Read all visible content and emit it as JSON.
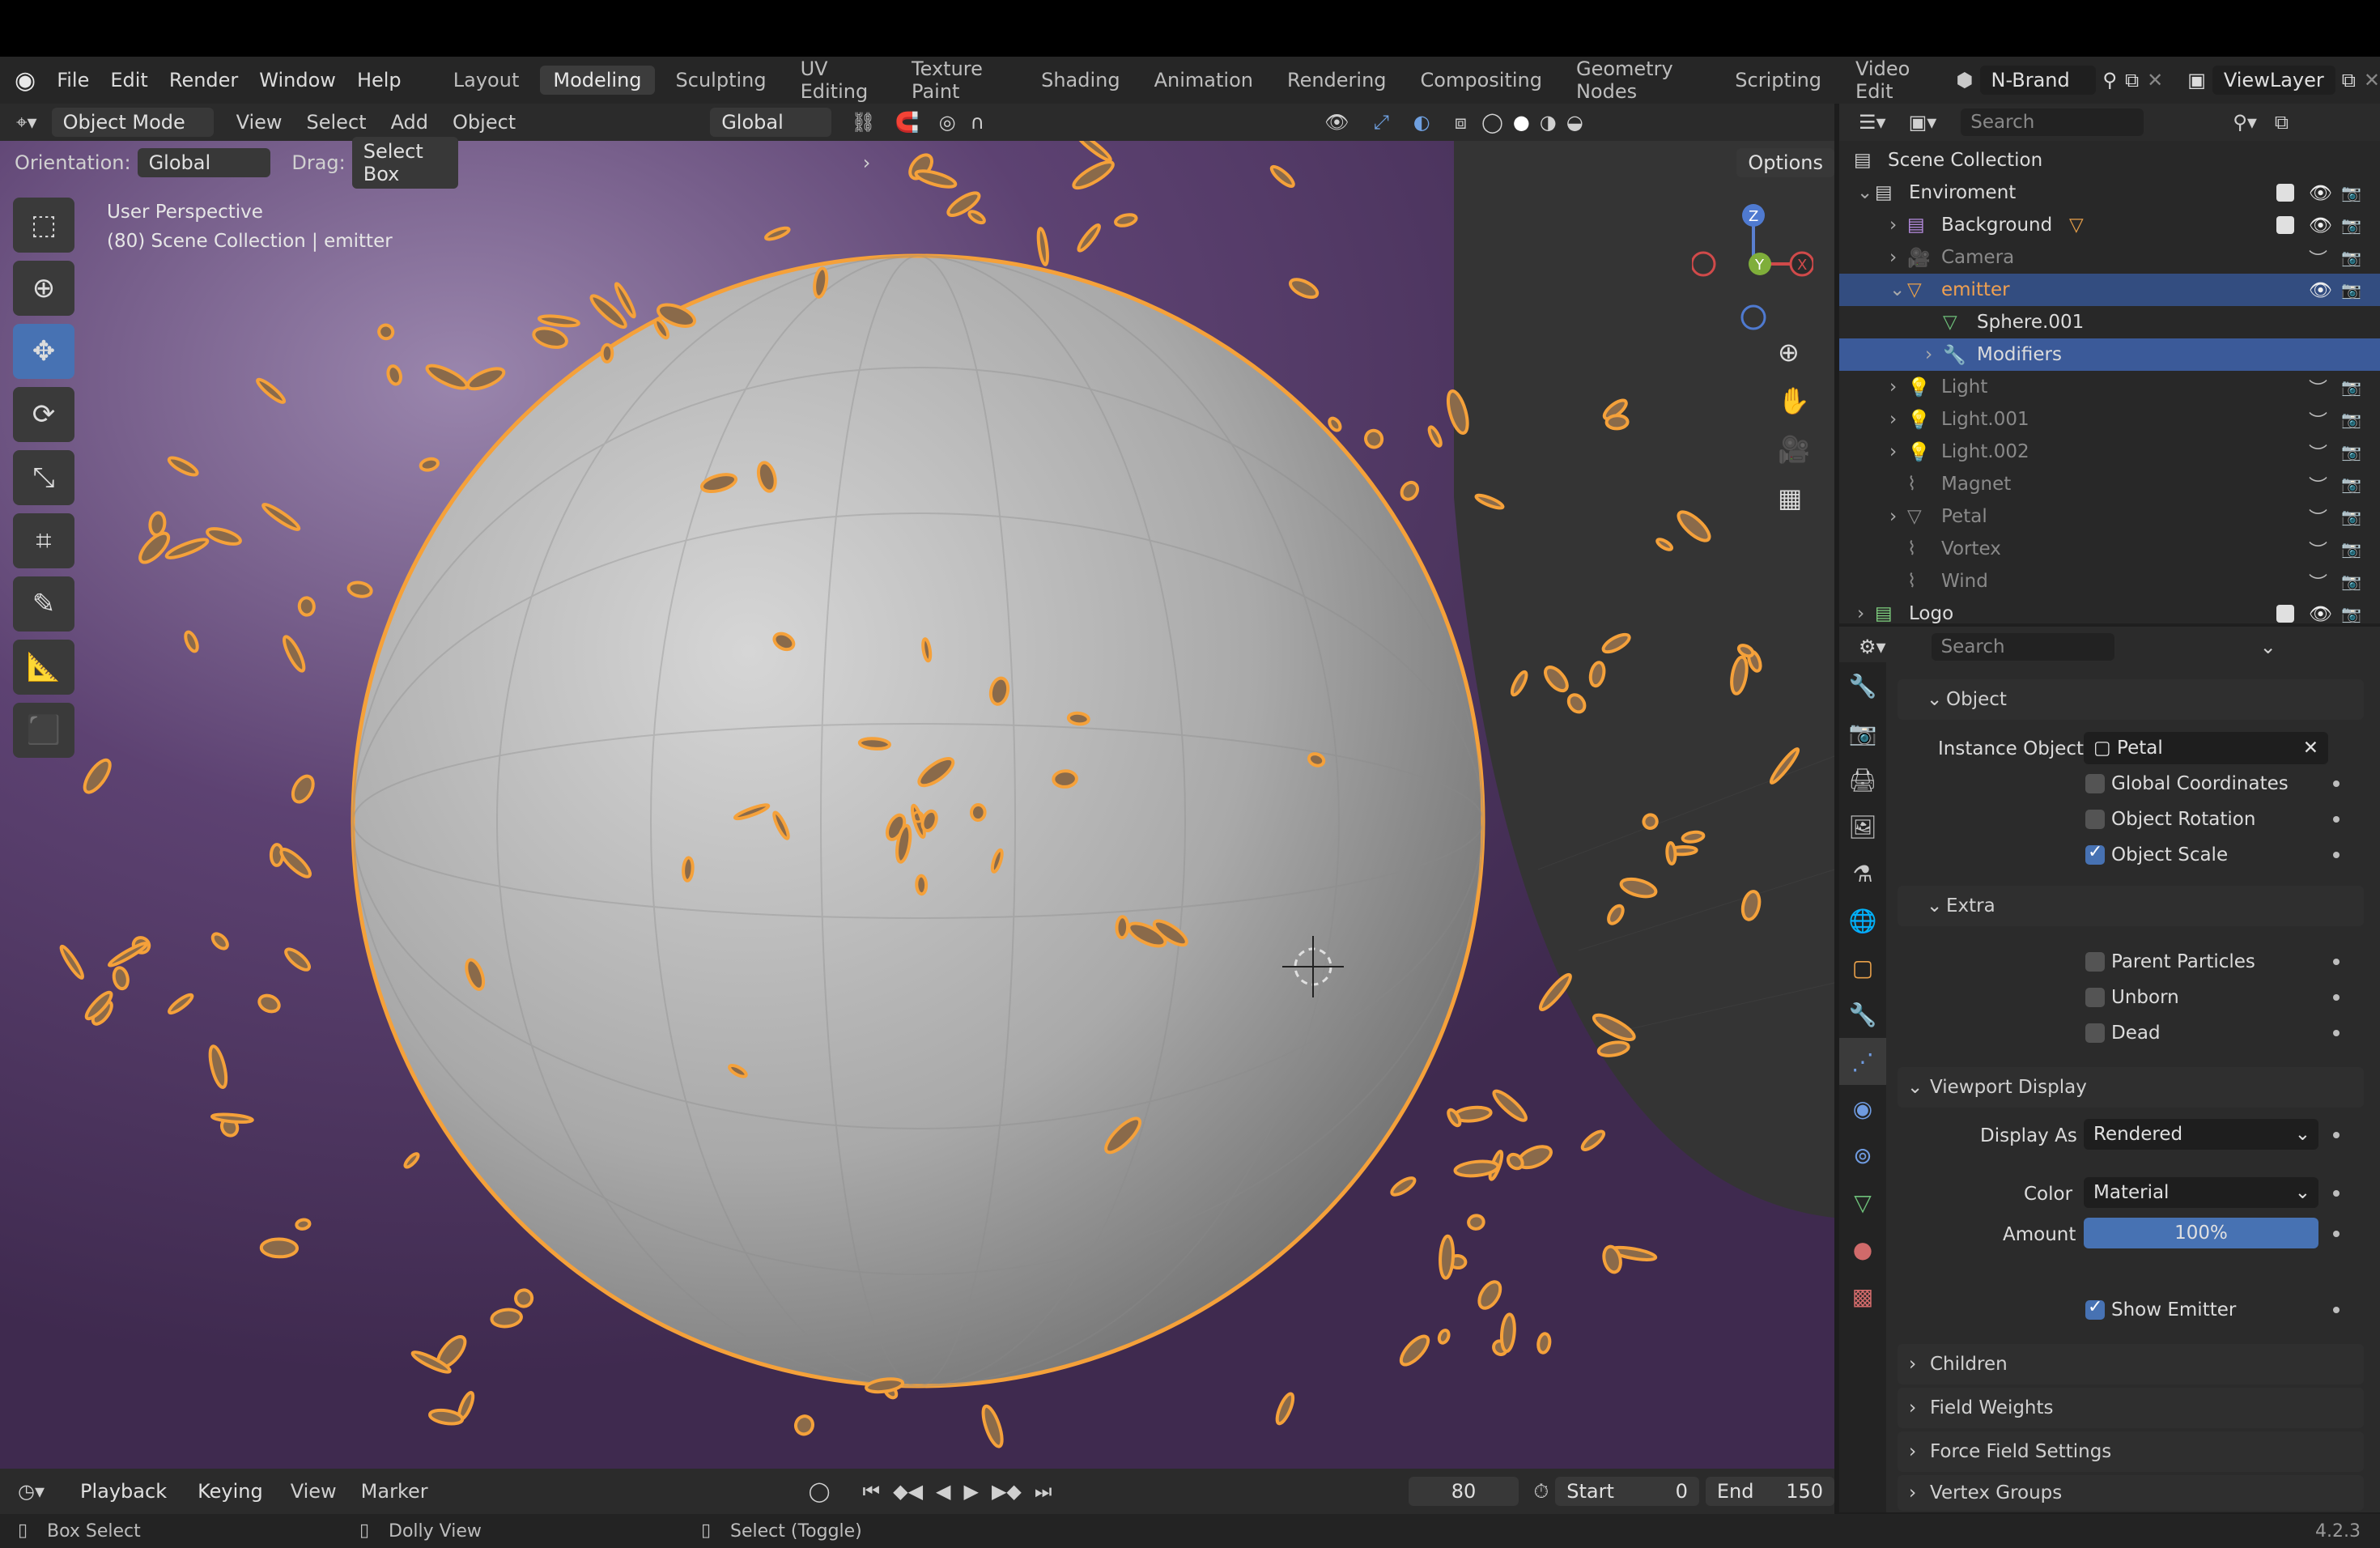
{
  "menu": {
    "file": "File",
    "edit": "Edit",
    "render": "Render",
    "window": "Window",
    "help": "Help"
  },
  "workspaces": [
    "Layout",
    "Modeling",
    "Sculpting",
    "UV Editing",
    "Texture Paint",
    "Shading",
    "Animation",
    "Rendering",
    "Compositing",
    "Geometry Nodes",
    "Scripting",
    "Video Edit"
  ],
  "active_workspace": "Modeling",
  "scene": {
    "name": "N-Brand",
    "view_layer": "ViewLayer"
  },
  "viewport_header": {
    "mode": "Object Mode",
    "view": "View",
    "select": "Select",
    "add": "Add",
    "object": "Object",
    "transform": "Global"
  },
  "viewport_options": {
    "orientation_label": "Orientation:",
    "orientation": "Global",
    "drag_label": "Drag:",
    "drag": "Select Box",
    "options": "Options"
  },
  "overlay": {
    "perspective": "User Perspective",
    "collection": "(80) Scene Collection | emitter"
  },
  "axes": {
    "z": "Z",
    "y": "Y",
    "x": "X"
  },
  "outliner": {
    "search_placeholder": "Search",
    "items": [
      {
        "label": "Scene Collection"
      },
      {
        "label": "Enviroment"
      },
      {
        "label": "Background"
      },
      {
        "label": "Camera"
      },
      {
        "label": "emitter"
      },
      {
        "label": "Sphere.001"
      },
      {
        "label": "Modifiers"
      },
      {
        "label": "Light"
      },
      {
        "label": "Light.001"
      },
      {
        "label": "Light.002"
      },
      {
        "label": "Magnet"
      },
      {
        "label": "Petal"
      },
      {
        "label": "Vortex"
      },
      {
        "label": "Wind"
      },
      {
        "label": "Logo"
      }
    ]
  },
  "properties": {
    "search_placeholder": "Search",
    "object_section": "Object",
    "instance_object_label": "Instance Object",
    "instance_object": "Petal",
    "global_coordinates": "Global Coordinates",
    "object_rotation": "Object Rotation",
    "object_scale": "Object Scale",
    "extra_section": "Extra",
    "parent_particles": "Parent Particles",
    "unborn": "Unborn",
    "dead": "Dead",
    "viewport_display_section": "Viewport Display",
    "display_as_label": "Display As",
    "display_as": "Rendered",
    "color_label": "Color",
    "color": "Material",
    "amount_label": "Amount",
    "amount": "100%",
    "amount_fraction": 1.0,
    "show_emitter": "Show Emitter",
    "children": "Children",
    "field_weights": "Field Weights",
    "force_field_settings": "Force Field Settings",
    "vertex_groups": "Vertex Groups"
  },
  "timeline": {
    "playback": "Playback",
    "keying": "Keying",
    "view": "View",
    "marker": "Marker",
    "frame": "80",
    "start_label": "Start",
    "start": "0",
    "end_label": "End",
    "end": "150"
  },
  "status": {
    "box_select": "Box Select",
    "dolly_view": "Dolly View",
    "select_toggle": "Select (Toggle)",
    "version": "4.2.3"
  },
  "colors": {
    "accent": "#4772b3",
    "selection_orange": "#f5a13a",
    "background_purple": "#5a3d6e",
    "menubar": "#262626"
  }
}
